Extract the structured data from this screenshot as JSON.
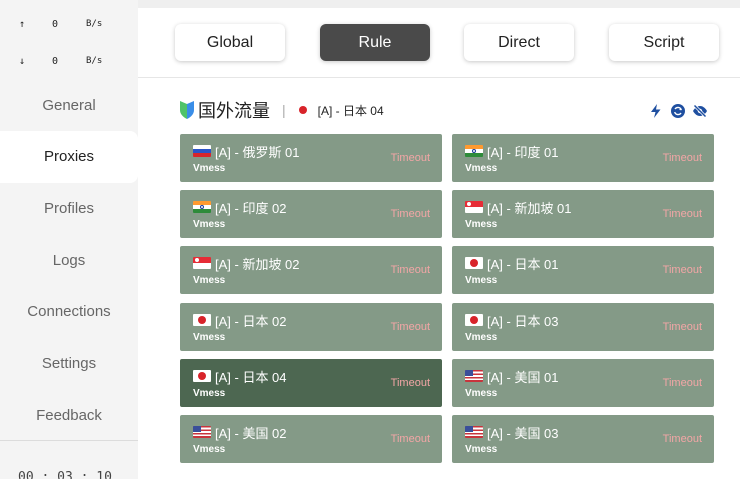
{
  "traffic": {
    "upload": {
      "arrow": "↑",
      "value": "0",
      "unit": "B/s"
    },
    "download": {
      "arrow": "↓",
      "value": "0",
      "unit": "B/s"
    }
  },
  "sidebar": {
    "items": [
      {
        "label": "General",
        "active": false
      },
      {
        "label": "Proxies",
        "active": true
      },
      {
        "label": "Profiles",
        "active": false
      },
      {
        "label": "Logs",
        "active": false
      },
      {
        "label": "Connections",
        "active": false
      },
      {
        "label": "Settings",
        "active": false
      },
      {
        "label": "Feedback",
        "active": false
      }
    ],
    "clock": "00 : 03 : 10"
  },
  "modes": [
    {
      "label": "Global",
      "active": false
    },
    {
      "label": "Rule",
      "active": true
    },
    {
      "label": "Direct",
      "active": false
    },
    {
      "label": "Script",
      "active": false
    }
  ],
  "group": {
    "icon": "shield-icon",
    "title": "国外流量",
    "separator": "|",
    "selected_flag": "jp",
    "selected": "[A] - 日本 04",
    "header_icons": [
      "lightning-icon",
      "speedtest-icon",
      "eye-off-icon"
    ]
  },
  "proxies": [
    {
      "flag": "ru",
      "name": "[A] - 俄罗斯 01",
      "type": "Vmess",
      "status": "Timeout",
      "selected": false
    },
    {
      "flag": "in",
      "name": "[A] - 印度 01",
      "type": "Vmess",
      "status": "Timeout",
      "selected": false
    },
    {
      "flag": "in",
      "name": "[A] - 印度 02",
      "type": "Vmess",
      "status": "Timeout",
      "selected": false
    },
    {
      "flag": "sg",
      "name": "[A] - 新加坡 01",
      "type": "Vmess",
      "status": "Timeout",
      "selected": false
    },
    {
      "flag": "sg",
      "name": "[A] - 新加坡 02",
      "type": "Vmess",
      "status": "Timeout",
      "selected": false
    },
    {
      "flag": "jp",
      "name": "[A] - 日本 01",
      "type": "Vmess",
      "status": "Timeout",
      "selected": false
    },
    {
      "flag": "jp",
      "name": "[A] - 日本 02",
      "type": "Vmess",
      "status": "Timeout",
      "selected": false
    },
    {
      "flag": "jp",
      "name": "[A] - 日本 03",
      "type": "Vmess",
      "status": "Timeout",
      "selected": false
    },
    {
      "flag": "jp",
      "name": "[A] - 日本 04",
      "type": "Vmess",
      "status": "Timeout",
      "selected": true
    },
    {
      "flag": "us",
      "name": "[A] - 美国 01",
      "type": "Vmess",
      "status": "Timeout",
      "selected": false
    },
    {
      "flag": "us",
      "name": "[A] - 美国 02",
      "type": "Vmess",
      "status": "Timeout",
      "selected": false
    },
    {
      "flag": "us",
      "name": "[A] - 美国 03",
      "type": "Vmess",
      "status": "Timeout",
      "selected": false
    }
  ],
  "colors": {
    "card": "#849a87",
    "card_selected": "#4d6751",
    "timeout": "#f3a6a6",
    "mode_active": "#4a4a4a",
    "accent_blue": "#1f4fa0"
  }
}
